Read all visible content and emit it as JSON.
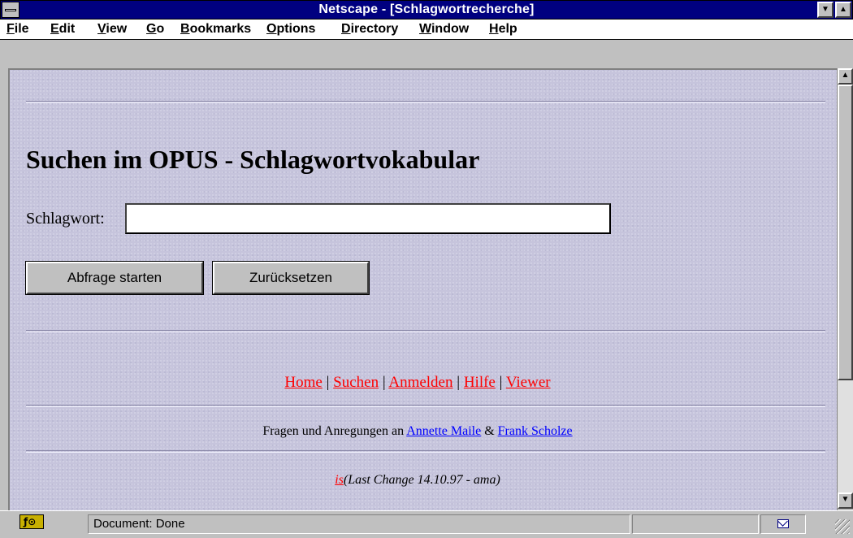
{
  "window": {
    "title": "Netscape - [Schlagwortrecherche]",
    "minimize_glyph": "▼",
    "maximize_glyph": "▲"
  },
  "menu": {
    "items": [
      {
        "label": "File",
        "mnemonic": "F"
      },
      {
        "label": "Edit",
        "mnemonic": "E"
      },
      {
        "label": "View",
        "mnemonic": "V"
      },
      {
        "label": "Go",
        "mnemonic": "G"
      },
      {
        "label": "Bookmarks",
        "mnemonic": "B"
      },
      {
        "label": "Options",
        "mnemonic": "O"
      },
      {
        "label": "Directory",
        "mnemonic": "D"
      },
      {
        "label": "Window",
        "mnemonic": "W"
      },
      {
        "label": "Help",
        "mnemonic": "H"
      }
    ]
  },
  "page": {
    "heading": "Suchen im OPUS - Schlagwortvokabular",
    "field_label": "Schlagwort:",
    "field_value": "",
    "submit_label": "Abfrage starten",
    "reset_label": "Zurücksetzen",
    "nav_links": [
      "Home",
      "Suchen",
      "Anmelden",
      "Hilfe",
      "Viewer"
    ],
    "nav_separator": " | ",
    "contact_prefix": "Fragen und Anregungen an ",
    "contact_person_1": "Annette Maile",
    "contact_join": " & ",
    "contact_person_2": "Frank Scholze",
    "lastchange_link": "is",
    "lastchange_text": "(Last Change 14.10.97 - ama)"
  },
  "scrollbar": {
    "up_glyph": "▲",
    "down_glyph": "▼"
  },
  "status": {
    "security_icon": "key-padlock-icon",
    "text": "Document: Done",
    "mail_icon": "mail-envelope-icon"
  },
  "colors": {
    "titlebar": "#000080",
    "page_background": "#c6c4dc",
    "link_visited": "#ff0000",
    "link_unvisited": "#0000ff"
  }
}
